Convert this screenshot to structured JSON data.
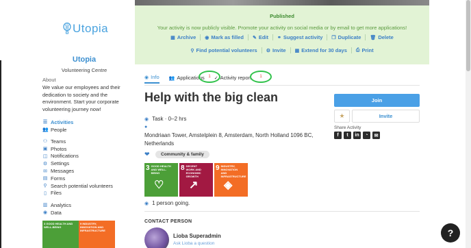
{
  "colors": {
    "brand": "#4aa3df",
    "published_bg": "#e2f3d5",
    "published_text": "#3c8a2e",
    "join": "#4aa0e6",
    "highlight_circle": "#31c24b"
  },
  "sidebar": {
    "logo_text": "Utopia",
    "org_name": "Utopia",
    "org_subtitle": "Volunteering Centre",
    "about_heading": "About",
    "about_text": "We value our employees and their dedication to society and the environment. Start your corporate volunteering journey now!",
    "menu_group1": [
      {
        "label": "Activities",
        "icon": "list-icon",
        "glyph": "☰",
        "active": true
      },
      {
        "label": "People",
        "icon": "people-icon",
        "glyph": "👥",
        "active": false
      }
    ],
    "menu_group2": [
      {
        "label": "Teams",
        "icon": "teams-icon",
        "glyph": "⚇"
      },
      {
        "label": "Photos",
        "icon": "photos-icon",
        "glyph": "▣"
      },
      {
        "label": "Notifications",
        "icon": "notifications-icon",
        "glyph": "◫"
      },
      {
        "label": "Settings",
        "icon": "gear-icon",
        "glyph": "⚙"
      },
      {
        "label": "Messages",
        "icon": "messages-icon",
        "glyph": "✉"
      },
      {
        "label": "Forms",
        "icon": "forms-icon",
        "glyph": "▤"
      },
      {
        "label": "Search potential volunteers",
        "icon": "search-icon",
        "glyph": "⚲"
      },
      {
        "label": "Files",
        "icon": "files-icon",
        "glyph": "▯"
      }
    ],
    "menu_group3": [
      {
        "label": "Analytics",
        "icon": "analytics-icon",
        "glyph": "▥"
      },
      {
        "label": "Data",
        "icon": "data-icon",
        "glyph": "◉"
      }
    ],
    "sdg_mini": [
      {
        "label": "3 GOOD HEALTH AND WELL-BEING",
        "color": "#4c9f38"
      },
      {
        "label": "9 INDUSTRY, INNOVATION AND INFRASTRUCTURE",
        "color": "#f36d25"
      }
    ]
  },
  "banner": {
    "status": "Published",
    "message": "Your activity is now publicly visible. Promote your activity on social media or by email to get more applications!",
    "actions_row1": [
      {
        "label": "Archive",
        "icon": "archive-icon",
        "glyph": "▦"
      },
      {
        "label": "Mark as filled",
        "icon": "check-circle-icon",
        "glyph": "◉"
      },
      {
        "label": "Edit",
        "icon": "edit-icon",
        "glyph": "✎"
      },
      {
        "label": "Suggest activity",
        "icon": "suggest-icon",
        "glyph": "⚭"
      },
      {
        "label": "Duplicate",
        "icon": "duplicate-icon",
        "glyph": "❐"
      },
      {
        "label": "Delete",
        "icon": "trash-icon",
        "glyph": "🗑"
      }
    ],
    "actions_row2": [
      {
        "label": "Find potential volunteers",
        "icon": "search-icon",
        "glyph": "⚲"
      },
      {
        "label": "Invite",
        "icon": "invite-icon",
        "glyph": "⚙"
      },
      {
        "label": "Extend for 30 days",
        "icon": "calendar-icon",
        "glyph": "▦"
      },
      {
        "label": "Print",
        "icon": "print-icon",
        "glyph": "⎙"
      }
    ]
  },
  "tabs": [
    {
      "label": "Info",
      "icon": "info-icon",
      "glyph": "◉",
      "active": true
    },
    {
      "label": "Applications",
      "icon": "people-icon",
      "glyph": "👥",
      "active": false
    },
    {
      "label": "Activity report",
      "icon": "report-icon",
      "glyph": "✓",
      "active": false
    }
  ],
  "badges": {
    "applications": "1",
    "activity_report": "1"
  },
  "activity": {
    "title": "Help with the big clean",
    "type": "Task · 0–2 hrs",
    "address": "Mondriaan Tower, Amstelplein 8, Amsterdam, North Holland 1096 BC, Netherlands",
    "category_tag": "Community & family",
    "sdgs": [
      {
        "num": "3",
        "caption": "GOOD HEALTH AND WELL-BEING",
        "color": "#4c9f38",
        "icon_name": "heartbeat-icon"
      },
      {
        "num": "8",
        "caption": "DECENT WORK AND ECONOMIC GROWTH",
        "color": "#a21942",
        "icon_name": "growth-chart-icon"
      },
      {
        "num": "9",
        "caption": "INDUSTRY, INNOVATION AND INFRASTRUCTURE",
        "color": "#f36d25",
        "icon_name": "cubes-icon"
      }
    ],
    "going": "1 person going."
  },
  "contact": {
    "heading": "CONTACT PERSON",
    "name": "Lioba Superadmin",
    "ask": "Ask Lioba a question"
  },
  "side_actions": {
    "join": "Join",
    "invite": "Invite",
    "share_heading": "Share Activity",
    "share_icons": [
      {
        "icon": "facebook-icon",
        "glyph": "f"
      },
      {
        "icon": "twitter-icon",
        "glyph": "t"
      },
      {
        "icon": "linkedin-icon",
        "glyph": "in"
      },
      {
        "icon": "whatsapp-icon",
        "glyph": "◔"
      },
      {
        "icon": "email-icon",
        "glyph": "✉"
      }
    ]
  },
  "help_label": "?"
}
